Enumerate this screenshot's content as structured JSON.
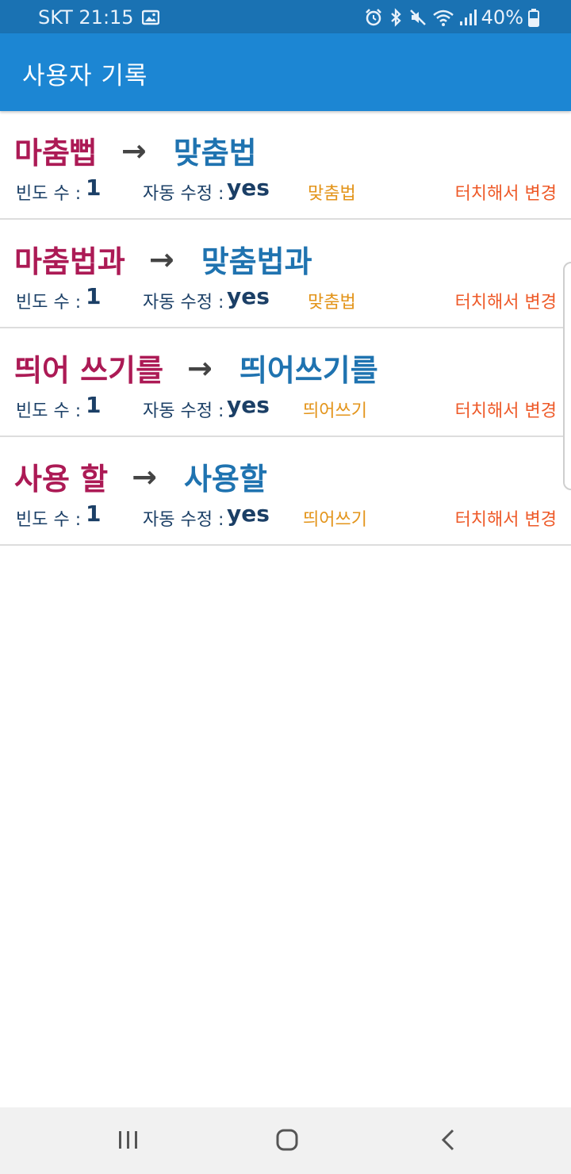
{
  "status_bar": {
    "carrier_time": "SKT 21:15",
    "battery": "40%",
    "icons": [
      "image-icon",
      "alarm-icon",
      "bluetooth-icon",
      "mute-icon",
      "wifi-icon",
      "signal-icon",
      "battery-icon"
    ]
  },
  "app_bar": {
    "title": "사용자 기록"
  },
  "colors": {
    "status_bar": "#1a72b3",
    "app_bar": "#1c86d3",
    "wrong_text": "#ac1a55",
    "correct_text": "#1f73b0",
    "meta_text": "#1b3f66",
    "type_text": "#e3941a",
    "touch_text": "#ee5a29"
  },
  "list": {
    "freq_label": "빈도 수 :",
    "auto_label": "자동 수정 :",
    "touch_label": "터치해서 변경",
    "arrow": "→",
    "items": [
      {
        "wrong": "마춤뻡",
        "correct": "맞춤법",
        "frequency": "1",
        "auto_fix": "yes",
        "type": "맞춤법"
      },
      {
        "wrong": "마춤법과",
        "correct": "맞춤법과",
        "frequency": "1",
        "auto_fix": "yes",
        "type": "맞춤법"
      },
      {
        "wrong": "띄어 쓰기를",
        "correct": "띄어쓰기를",
        "frequency": "1",
        "auto_fix": "yes",
        "type": "띄어쓰기"
      },
      {
        "wrong": "사용 할",
        "correct": "사용할",
        "frequency": "1",
        "auto_fix": "yes",
        "type": "띄어쓰기"
      }
    ]
  },
  "nav_bar": {
    "buttons": [
      "recent-apps-icon",
      "home-icon",
      "back-icon"
    ]
  }
}
